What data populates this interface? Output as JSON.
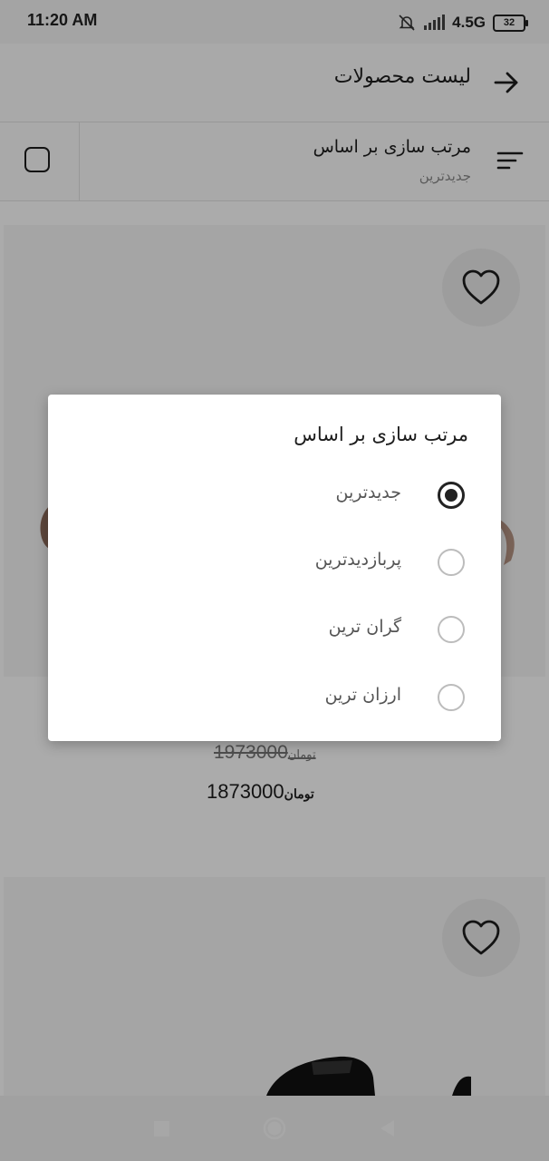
{
  "status_bar": {
    "time": "11:20 AM",
    "network": "4.5G",
    "battery": "32"
  },
  "app_bar": {
    "title": "لیست محصولات",
    "back_icon": "arrow-right-icon"
  },
  "sort_bar": {
    "title": "مرتب سازی بر اساس",
    "current": "جدیدترین",
    "icon": "sort-lines-icon",
    "view_toggle_icon": "square-outline-icon"
  },
  "products": [
    {
      "old_price": "1973000",
      "new_price": "1873000",
      "currency": "تومان",
      "favorite_icon": "heart-outline-icon"
    },
    {
      "favorite_icon": "heart-outline-icon"
    }
  ],
  "sort_dialog": {
    "title": "مرتب سازی بر اساس",
    "options": [
      {
        "label": "جدیدترین",
        "selected": true
      },
      {
        "label": "پربازدیدترین",
        "selected": false
      },
      {
        "label": "گران ترین",
        "selected": false
      },
      {
        "label": "ارزان ترین",
        "selected": false
      }
    ]
  },
  "nav_bar": {
    "icons": [
      "square-recents-icon",
      "circle-home-icon",
      "triangle-back-icon"
    ]
  }
}
